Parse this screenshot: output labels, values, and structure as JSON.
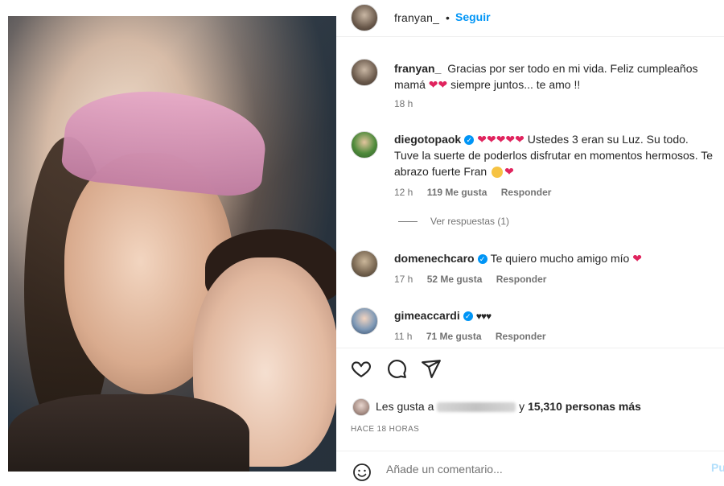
{
  "header": {
    "username": "franyan_",
    "separator": "•",
    "follow_label": "Seguir"
  },
  "caption": {
    "username": "franyan_",
    "text_1": "Gracias por ser todo en mi vida. Feliz cumpleaños mamá",
    "text_2": "siempre juntos... te amo !!",
    "time": "18 h"
  },
  "comments": [
    {
      "username": "diegotopaok",
      "verified": true,
      "text": "Ustedes 3 eran su Luz. Su todo. Tuve la suerte de poderlos disfrutar en momentos hermosos. Te abrazo fuerte Fran",
      "time": "12 h",
      "likes": "119 Me gusta",
      "reply": "Responder"
    },
    {
      "username": "domenechcaro",
      "verified": true,
      "text": "Te quiero mucho amigo mío",
      "time": "17 h",
      "likes": "52 Me gusta",
      "reply": "Responder"
    },
    {
      "username": "gimeaccardi",
      "verified": true,
      "text": "♥♥♥",
      "time": "11 h",
      "likes": "71 Me gusta",
      "reply": "Responder"
    }
  ],
  "view_replies": "Ver respuestas (1)",
  "likes": {
    "prefix": "Les gusta a",
    "suffix_y": "y",
    "count": "15,310 personas más"
  },
  "timestamp": "HACE 18 HORAS",
  "comment_box": {
    "placeholder": "Añade un comentario...",
    "post_label": "Pu"
  },
  "icons": {
    "like": "heart-outline-icon",
    "comment": "speech-bubble-icon",
    "share": "paper-plane-icon",
    "emoji": "smiley-icon"
  },
  "colors": {
    "accent": "#0095f6",
    "heart": "#e0245e",
    "muted": "#737373"
  }
}
